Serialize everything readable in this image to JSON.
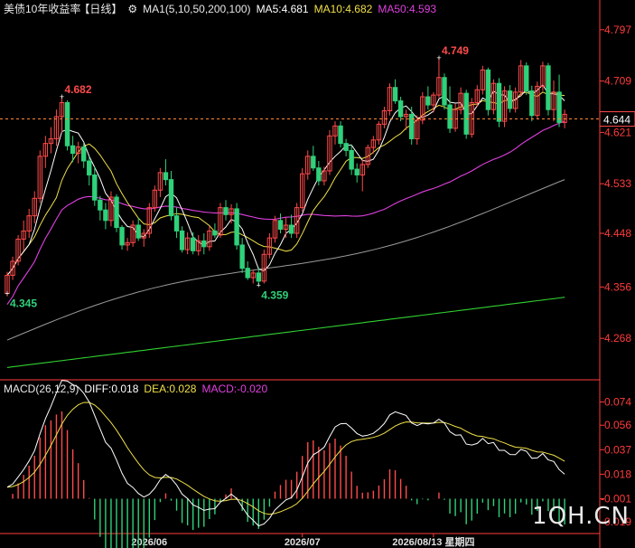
{
  "header": {
    "symbol": "美债10年收益率",
    "period": "【日线】",
    "settings_icon": "gear-icon",
    "ma_label": "MA1(5,10,50,200,100)",
    "ma5": "MA5:4.681",
    "ma10": "MA10:4.682",
    "ma50": "MA50:4.593"
  },
  "macd_header": {
    "label": "MACD(26,12,9)",
    "diff": "DIFF:0.018",
    "dea": "DEA:0.028",
    "macd": "MACD:-0.020"
  },
  "watermark": "1QH.CN",
  "colors": {
    "up": "#ff4a4a",
    "down": "#2fd17a",
    "ma5": "#ffffff",
    "ma10": "#f0e048",
    "ma50": "#e040e0",
    "ma100": "#9a9a9a",
    "ma200": "#30d030",
    "axis": "#ff3b3b",
    "last_price_tag": "#ff4a4a"
  },
  "chart_data": [
    {
      "type": "candlestick",
      "price_axis": {
        "ticks": [
          4.268,
          4.356,
          4.448,
          4.533,
          4.621,
          4.709,
          4.797
        ],
        "ylim": [
          4.2,
          4.82
        ]
      },
      "last_price": 4.644,
      "annotations": [
        {
          "label": "4.682",
          "value": 4.682,
          "index": 10,
          "kind": "high"
        },
        {
          "label": "4.345",
          "value": 4.345,
          "index": 0,
          "kind": "low"
        },
        {
          "label": "4.359",
          "value": 4.359,
          "index": 46,
          "kind": "low"
        },
        {
          "label": "4.749",
          "value": 4.749,
          "index": 79,
          "kind": "high"
        }
      ],
      "x_labels": [
        {
          "index": 26,
          "label": "2026/06"
        },
        {
          "index": 54,
          "label": "2026/07"
        },
        {
          "index": 78,
          "label": "2026/08/13 星期四"
        }
      ],
      "ohlc": [
        [
          4.345,
          4.382,
          4.34,
          4.376
        ],
        [
          4.376,
          4.408,
          4.368,
          4.4
        ],
        [
          4.4,
          4.445,
          4.393,
          4.438
        ],
        [
          4.438,
          4.47,
          4.418,
          4.452
        ],
        [
          4.452,
          4.49,
          4.44,
          4.478
        ],
        [
          4.478,
          4.52,
          4.465,
          4.508
        ],
        [
          4.508,
          4.59,
          4.5,
          4.58
        ],
        [
          4.58,
          4.615,
          4.56,
          4.602
        ],
        [
          4.602,
          4.63,
          4.585,
          4.61
        ],
        [
          4.61,
          4.66,
          4.598,
          4.648
        ],
        [
          4.648,
          4.682,
          4.62,
          4.672
        ],
        [
          4.672,
          4.676,
          4.59,
          4.598
        ],
        [
          4.598,
          4.615,
          4.57,
          4.585
        ],
        [
          4.585,
          4.605,
          4.568,
          4.596
        ],
        [
          4.596,
          4.604,
          4.56,
          4.572
        ],
        [
          4.572,
          4.58,
          4.53,
          4.548
        ],
        [
          4.548,
          4.562,
          4.495,
          4.505
        ],
        [
          4.505,
          4.512,
          4.47,
          4.488
        ],
        [
          4.488,
          4.5,
          4.455,
          4.47
        ],
        [
          4.47,
          4.52,
          4.46,
          4.51
        ],
        [
          4.51,
          4.515,
          4.45,
          4.458
        ],
        [
          4.458,
          4.462,
          4.42,
          4.428
        ],
        [
          4.428,
          4.44,
          4.418,
          4.432
        ],
        [
          4.432,
          4.47,
          4.425,
          4.462
        ],
        [
          4.462,
          4.475,
          4.435,
          4.44
        ],
        [
          4.44,
          4.455,
          4.425,
          4.448
        ],
        [
          4.448,
          4.5,
          4.44,
          4.492
        ],
        [
          4.492,
          4.53,
          4.485,
          4.522
        ],
        [
          4.522,
          4.56,
          4.51,
          4.552
        ],
        [
          4.552,
          4.575,
          4.53,
          4.54
        ],
        [
          4.54,
          4.555,
          4.47,
          4.478
        ],
        [
          4.478,
          4.492,
          4.44,
          4.452
        ],
        [
          4.452,
          4.46,
          4.415,
          4.42
        ],
        [
          4.42,
          4.45,
          4.412,
          4.44
        ],
        [
          4.44,
          4.45,
          4.412,
          4.418
        ],
        [
          4.418,
          4.445,
          4.41,
          4.435
        ],
        [
          4.435,
          4.448,
          4.412,
          4.425
        ],
        [
          4.425,
          4.46,
          4.418,
          4.452
        ],
        [
          4.452,
          4.465,
          4.44,
          4.445
        ],
        [
          4.445,
          4.5,
          4.44,
          4.492
        ],
        [
          4.492,
          4.505,
          4.47,
          4.48
        ],
        [
          4.48,
          4.498,
          4.465,
          4.49
        ],
        [
          4.49,
          4.5,
          4.42,
          4.428
        ],
        [
          4.428,
          4.44,
          4.38,
          4.388
        ],
        [
          4.388,
          4.4,
          4.368,
          4.372
        ],
        [
          4.372,
          4.385,
          4.362,
          4.38
        ],
        [
          4.38,
          4.39,
          4.359,
          4.366
        ],
        [
          4.366,
          4.42,
          4.362,
          4.412
        ],
        [
          4.412,
          4.448,
          4.405,
          4.44
        ],
        [
          4.44,
          4.478,
          4.432,
          4.47
        ],
        [
          4.47,
          4.482,
          4.448,
          4.455
        ],
        [
          4.455,
          4.475,
          4.44,
          4.462
        ],
        [
          4.462,
          4.48,
          4.44,
          4.448
        ],
        [
          4.448,
          4.5,
          4.44,
          4.492
        ],
        [
          4.492,
          4.56,
          4.485,
          4.55
        ],
        [
          4.55,
          4.59,
          4.54,
          4.58
        ],
        [
          4.58,
          4.598,
          4.555,
          4.56
        ],
        [
          4.56,
          4.572,
          4.53,
          4.538
        ],
        [
          4.538,
          4.562,
          4.53,
          4.555
        ],
        [
          4.555,
          4.625,
          4.548,
          4.615
        ],
        [
          4.615,
          4.64,
          4.6,
          4.632
        ],
        [
          4.632,
          4.64,
          4.595,
          4.602
        ],
        [
          4.602,
          4.61,
          4.58,
          4.59
        ],
        [
          4.59,
          4.6,
          4.548,
          4.558
        ],
        [
          4.558,
          4.568,
          4.535,
          4.548
        ],
        [
          4.548,
          4.575,
          4.52,
          4.566
        ],
        [
          4.566,
          4.6,
          4.56,
          4.595
        ],
        [
          4.595,
          4.615,
          4.585,
          4.608
        ],
        [
          4.608,
          4.64,
          4.6,
          4.635
        ],
        [
          4.635,
          4.665,
          4.628,
          4.658
        ],
        [
          4.658,
          4.705,
          4.65,
          4.698
        ],
        [
          4.698,
          4.712,
          4.67,
          4.675
        ],
        [
          4.675,
          4.682,
          4.64,
          4.648
        ],
        [
          4.648,
          4.66,
          4.625,
          4.652
        ],
        [
          4.652,
          4.665,
          4.6,
          4.61
        ],
        [
          4.61,
          4.65,
          4.6,
          4.642
        ],
        [
          4.642,
          4.69,
          4.635,
          4.682
        ],
        [
          4.682,
          4.7,
          4.66,
          4.668
        ],
        [
          4.668,
          4.69,
          4.655,
          4.685
        ],
        [
          4.685,
          4.749,
          4.68,
          4.715
        ],
        [
          4.715,
          4.722,
          4.66,
          4.668
        ],
        [
          4.668,
          4.7,
          4.62,
          4.628
        ],
        [
          4.628,
          4.67,
          4.622,
          4.66
        ],
        [
          4.66,
          4.698,
          4.652,
          4.688
        ],
        [
          4.688,
          4.694,
          4.61,
          4.618
        ],
        [
          4.618,
          4.68,
          4.612,
          4.672
        ],
        [
          4.672,
          4.702,
          4.665,
          4.694
        ],
        [
          4.694,
          4.735,
          4.686,
          4.728
        ],
        [
          4.728,
          4.732,
          4.65,
          4.66
        ],
        [
          4.66,
          4.712,
          4.652,
          4.705
        ],
        [
          4.705,
          4.714,
          4.63,
          4.64
        ],
        [
          4.64,
          4.7,
          4.63,
          4.692
        ],
        [
          4.692,
          4.702,
          4.655,
          4.662
        ],
        [
          4.662,
          4.698,
          4.655,
          4.69
        ],
        [
          4.69,
          4.745,
          4.684,
          4.735
        ],
        [
          4.735,
          4.741,
          4.685,
          4.692
        ],
        [
          4.692,
          4.701,
          4.64,
          4.65
        ],
        [
          4.65,
          4.708,
          4.645,
          4.7
        ],
        [
          4.7,
          4.742,
          4.692,
          4.735
        ],
        [
          4.735,
          4.74,
          4.65,
          4.66
        ],
        [
          4.66,
          4.71,
          4.64,
          4.69
        ],
        [
          4.69,
          4.72,
          4.63,
          4.638
        ],
        [
          4.638,
          4.66,
          4.628,
          4.652
        ]
      ]
    },
    {
      "type": "macd",
      "ticks": [
        0.074,
        0.056,
        0.037,
        0.018,
        -0.001,
        -0.019
      ],
      "ylim": [
        -0.028,
        0.08
      ],
      "diff_last": 0.018,
      "dea_last": 0.028,
      "macd_last": -0.02
    }
  ]
}
